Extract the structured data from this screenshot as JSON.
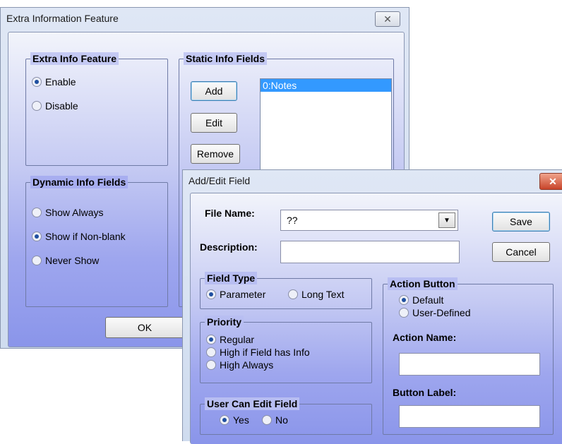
{
  "main_window": {
    "title": "Extra Information Feature",
    "close_glyph": "✕",
    "extra_info": {
      "label": "Extra Info Feature",
      "options": [
        {
          "label": "Enable",
          "selected": true
        },
        {
          "label": "Disable",
          "selected": false
        }
      ]
    },
    "dynamic_info": {
      "label": "Dynamic Info Fields",
      "options": [
        {
          "label": "Show Always",
          "selected": false
        },
        {
          "label": "Show if Non-blank",
          "selected": true
        },
        {
          "label": "Never Show",
          "selected": false
        }
      ]
    },
    "static_info": {
      "label": "Static Info Fields",
      "add_label": "Add",
      "edit_label": "Edit",
      "remove_label": "Remove",
      "items": [
        "0:Notes"
      ]
    },
    "ok_label": "OK"
  },
  "dialog": {
    "title": "Add/Edit Field",
    "close_glyph": "✕",
    "file_name_label": "File Name:",
    "file_name_value": "??",
    "dropdown_icon": "▼",
    "description_label": "Description:",
    "description_value": "",
    "save_label": "Save",
    "cancel_label": "Cancel",
    "field_type": {
      "label": "Field Type",
      "options": [
        {
          "label": "Parameter",
          "selected": true
        },
        {
          "label": "Long Text",
          "selected": false
        }
      ]
    },
    "priority": {
      "label": "Priority",
      "options": [
        {
          "label": "Regular",
          "selected": true
        },
        {
          "label": "High if Field has Info",
          "selected": false
        },
        {
          "label": "High Always",
          "selected": false
        }
      ]
    },
    "user_can_edit": {
      "label": "User Can Edit Field",
      "options": [
        {
          "label": "Yes",
          "selected": true
        },
        {
          "label": "No",
          "selected": false
        }
      ]
    },
    "action_button": {
      "label": "Action Button",
      "options": [
        {
          "label": "Default",
          "selected": true
        },
        {
          "label": "User-Defined",
          "selected": false
        }
      ],
      "action_name_label": "Action Name:",
      "action_name_value": "",
      "button_label_label": "Button Label:",
      "button_label_value": ""
    }
  }
}
